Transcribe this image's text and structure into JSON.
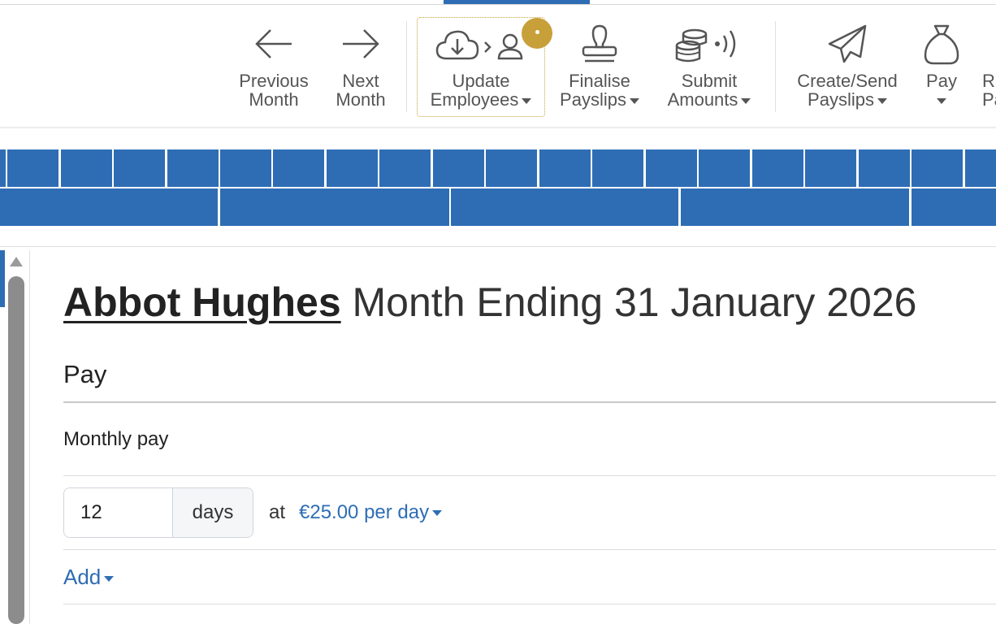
{
  "toolbar": {
    "previous_month": [
      "Previous",
      "Month"
    ],
    "next_month": [
      "Next",
      "Month"
    ],
    "update_employees": [
      "Update",
      "Employees"
    ],
    "finalise_payslips": [
      "Finalise",
      "Payslips"
    ],
    "submit_amounts": [
      "Submit",
      "Amounts"
    ],
    "create_send_payslips": [
      "Create/Send",
      "Payslips"
    ],
    "pay": [
      "Pay",
      ""
    ],
    "cutoff_button": [
      "R",
      "Pa"
    ]
  },
  "colors": {
    "accent": "#2e6db4",
    "badge": "#c8a03a"
  },
  "page": {
    "employee_name": "Abbot Hughes",
    "title_rest": " Month Ending 31 January 2026"
  },
  "pay": {
    "section_title": "Pay",
    "item_label": "Monthly pay",
    "quantity": "12",
    "unit": "days",
    "at": "at",
    "rate": "€25.00 per day",
    "add_label": "Add"
  }
}
